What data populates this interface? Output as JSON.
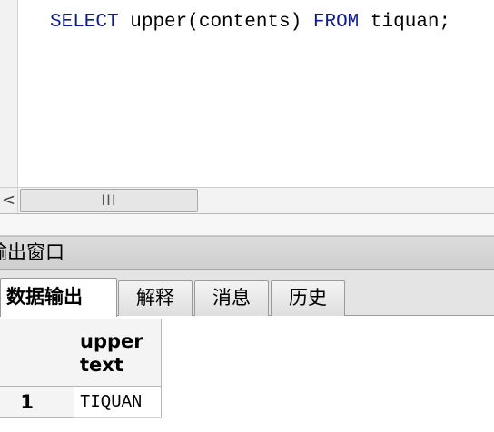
{
  "editor": {
    "sql": {
      "kw_select": "SELECT",
      "func_call": "upper(contents)",
      "kw_from": "FROM",
      "table": "tiquan;"
    }
  },
  "scrollbar": {
    "left_arrow": "<",
    "thumb_grip": "III"
  },
  "output_panel": {
    "title": "输出窗口",
    "tabs": [
      {
        "label": "数据输出",
        "active": true
      },
      {
        "label": "解释",
        "active": false
      },
      {
        "label": "消息",
        "active": false
      },
      {
        "label": "历史",
        "active": false
      }
    ]
  },
  "grid": {
    "column": {
      "name": "upper",
      "type": "text"
    },
    "rows": [
      {
        "num": "1",
        "value": "TIQUAN"
      }
    ]
  }
}
